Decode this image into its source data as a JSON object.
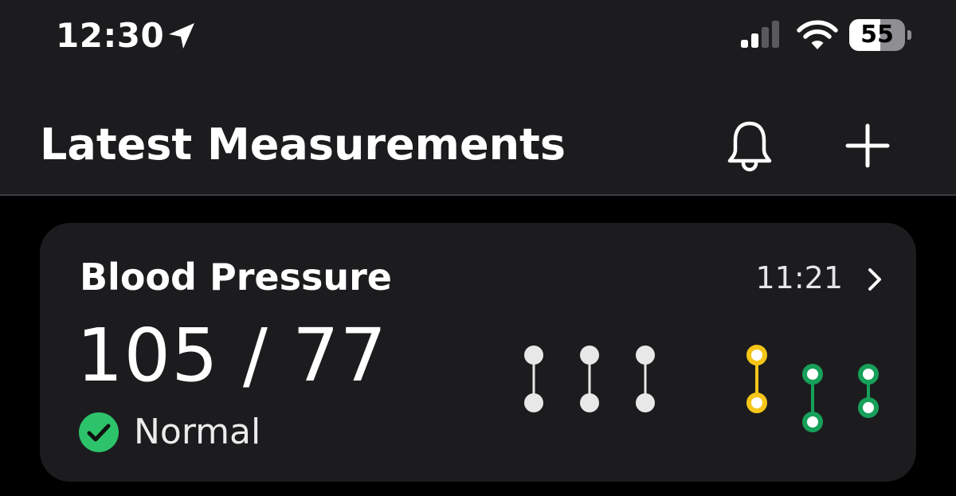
{
  "status_bar": {
    "time": "12:30",
    "location_icon": "location-arrow-icon",
    "signal_icon": "cellular-signal-icon",
    "signal_bars_active": 2,
    "wifi_icon": "wifi-icon",
    "battery_percent": "55",
    "battery_level": 0.55
  },
  "header": {
    "title": "Latest Measurements",
    "bell_icon": "bell-icon",
    "add_icon": "plus-icon"
  },
  "card": {
    "title": "Blood Pressure",
    "time": "11:21",
    "chevron_icon": "chevron-right-icon",
    "value": "105 / 77",
    "status": {
      "label": "Normal",
      "icon": "check-circle-icon",
      "color": "#2dc36b"
    }
  },
  "colors": {
    "background": "#000000",
    "surface": "#1c1c1e",
    "divider": "#3d3b46",
    "past_reading": "#e8e8e8",
    "elevated": "#f5c518",
    "normal": "#16a05a"
  },
  "chart_data": {
    "type": "range",
    "readings": [
      {
        "high": 1.0,
        "low": 0.5,
        "status": "past"
      },
      {
        "high": 1.0,
        "low": 0.5,
        "status": "past"
      },
      {
        "high": 1.0,
        "low": 0.5,
        "status": "past"
      },
      {
        "high": 1.0,
        "low": 0.5,
        "status": "elevated"
      },
      {
        "high": 0.8,
        "low": 0.3,
        "status": "normal"
      },
      {
        "high": 0.8,
        "low": 0.45,
        "status": "normal"
      }
    ]
  }
}
